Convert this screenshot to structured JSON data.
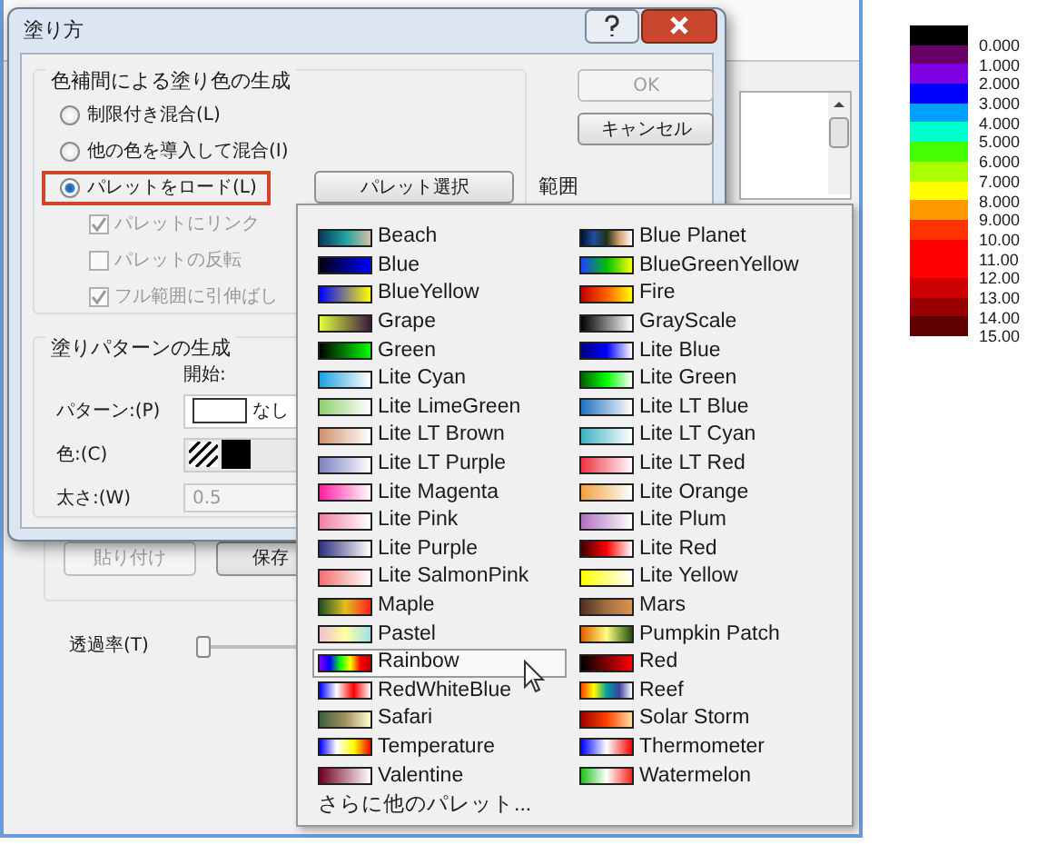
{
  "background_window": {
    "paste_button": {
      "label": "貼り付け",
      "disabled": true
    },
    "save_button": {
      "label": "保存",
      "disabled": false
    },
    "transparency": {
      "label": "透過率(T)",
      "level": 0
    }
  },
  "dialog": {
    "title": "塗り方",
    "interpolation_group": {
      "title": "色補間による塗り色の生成",
      "radios": [
        {
          "label": "制限付き混合(L)",
          "selected": false,
          "highlighted": false
        },
        {
          "label": "他の色を導入して混合(I)",
          "selected": false,
          "highlighted": false
        },
        {
          "label": "パレットをロード(L)",
          "selected": true,
          "highlighted": true
        }
      ],
      "palette_button": "パレット選択",
      "options": [
        {
          "label": "パレットにリンク",
          "checked": true,
          "disabled": true
        },
        {
          "label": "パレットの反転",
          "checked": false,
          "disabled": true
        },
        {
          "label": "フル範囲に引伸ばし",
          "checked": true,
          "disabled": true
        }
      ]
    },
    "ok_button": {
      "label": "OK",
      "disabled": true
    },
    "cancel_button": {
      "label": "キャンセル",
      "disabled": false
    },
    "range_label": "範囲",
    "pattern_group": {
      "title": "塗りパターンの生成",
      "start_label": "開始:",
      "pattern": {
        "label": "パターン:(P)",
        "value": "なし"
      },
      "color": {
        "label": "色:(C)"
      },
      "width": {
        "label": "太さ:(W)",
        "value": "0.5",
        "disabled": true
      }
    }
  },
  "palette_menu": {
    "columns": [
      [
        {
          "name": "Beach",
          "selected": false
        },
        {
          "name": "Blue",
          "selected": false
        },
        {
          "name": "BlueYellow",
          "selected": false
        },
        {
          "name": "Grape",
          "selected": false
        },
        {
          "name": "Green",
          "selected": false
        },
        {
          "name": "Lite Cyan",
          "selected": false
        },
        {
          "name": "Lite LimeGreen",
          "selected": false
        },
        {
          "name": "Lite LT Brown",
          "selected": false
        },
        {
          "name": "Lite LT Purple",
          "selected": false
        },
        {
          "name": "Lite Magenta",
          "selected": false
        },
        {
          "name": "Lite Pink",
          "selected": false
        },
        {
          "name": "Lite Purple",
          "selected": false
        },
        {
          "name": "Lite SalmonPink",
          "selected": false
        },
        {
          "name": "Maple",
          "selected": false
        },
        {
          "name": "Pastel",
          "selected": false
        },
        {
          "name": "Rainbow",
          "selected": true
        },
        {
          "name": "RedWhiteBlue",
          "selected": false
        },
        {
          "name": "Safari",
          "selected": false
        },
        {
          "name": "Temperature",
          "selected": false
        },
        {
          "name": "Valentine",
          "selected": false
        }
      ],
      [
        {
          "name": "Blue Planet",
          "selected": false
        },
        {
          "name": "BlueGreenYellow",
          "selected": false
        },
        {
          "name": "Fire",
          "selected": false
        },
        {
          "name": "GrayScale",
          "selected": false
        },
        {
          "name": "Lite Blue",
          "selected": false
        },
        {
          "name": "Lite Green",
          "selected": false
        },
        {
          "name": "Lite LT Blue",
          "selected": false
        },
        {
          "name": "Lite LT Cyan",
          "selected": false
        },
        {
          "name": "Lite LT Red",
          "selected": false
        },
        {
          "name": "Lite Orange",
          "selected": false
        },
        {
          "name": "Lite Plum",
          "selected": false
        },
        {
          "name": "Lite Red",
          "selected": false
        },
        {
          "name": "Lite Yellow",
          "selected": false
        },
        {
          "name": "Mars",
          "selected": false
        },
        {
          "name": "Pumpkin Patch",
          "selected": false
        },
        {
          "name": "Red",
          "selected": false
        },
        {
          "name": "Reef",
          "selected": false
        },
        {
          "name": "Solar Storm",
          "selected": false
        },
        {
          "name": "Thermometer",
          "selected": false
        },
        {
          "name": "Watermelon",
          "selected": false
        }
      ]
    ],
    "more": "さらに他のパレット..."
  },
  "legend": [
    {
      "color": "#000000",
      "label": "0.000"
    },
    {
      "color": "#660066",
      "label": "1.000"
    },
    {
      "color": "#7f00e0",
      "label": "2.000"
    },
    {
      "color": "#0000ff",
      "label": "3.000"
    },
    {
      "color": "#00a0ff",
      "label": "4.000"
    },
    {
      "color": "#00ffcc",
      "label": "5.000"
    },
    {
      "color": "#44ff00",
      "label": "6.000"
    },
    {
      "color": "#aaff00",
      "label": "7.000"
    },
    {
      "color": "#ffff00",
      "label": "8.000"
    },
    {
      "color": "#ff9900",
      "label": "9.000"
    },
    {
      "color": "#ff3300",
      "label": "10.00"
    },
    {
      "color": "#ff0000",
      "label": "11.00"
    },
    {
      "color": "#ff0000",
      "label": "12.00"
    },
    {
      "color": "#cc0000",
      "label": "13.00"
    },
    {
      "color": "#990000",
      "label": "14.00"
    },
    {
      "color": "#600000",
      "label": "15.00"
    }
  ]
}
